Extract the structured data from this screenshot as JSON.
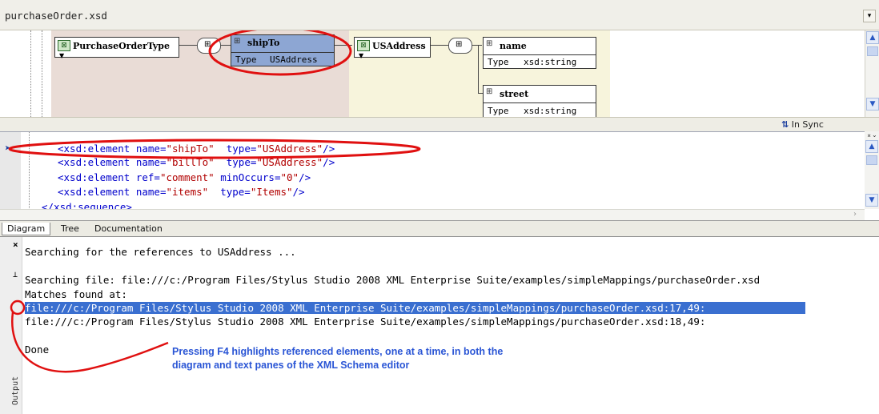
{
  "window": {
    "title": "purchaseOrder.xsd",
    "dropdown_icon": "chevron-down-icon"
  },
  "diagram": {
    "nodes": [
      {
        "label": "PurchaseOrderType"
      },
      {
        "label": "shipTo",
        "type_label": "Type",
        "type_value": "USAddress"
      },
      {
        "label": "USAddress"
      },
      {
        "label": "name",
        "type_label": "Type",
        "type_value": "xsd:string"
      },
      {
        "label": "street",
        "type_label": "Type",
        "type_value": "xsd:string"
      }
    ]
  },
  "sync": {
    "label": "In Sync",
    "icon": "sync-arrows-icon"
  },
  "code": {
    "lines": [
      {
        "tag": "<xsd:element",
        "a1": " name=",
        "v1": "\"shipTo\"",
        "a2": "  type=",
        "v2": "\"USAddress\"",
        "end": "/>"
      },
      {
        "tag": "<xsd:element",
        "a1": " name=",
        "v1": "\"billTo\"",
        "a2": "  type=",
        "v2": "\"USAddress\"",
        "end": "/>"
      },
      {
        "tag": "<xsd:element",
        "a1": " ref=",
        "v1": "\"comment\"",
        "a2": " minOccurs=",
        "v2": "\"0\"",
        "end": "/>"
      },
      {
        "tag": "<xsd:element",
        "a1": " name=",
        "v1": "\"items\"",
        "a2": "  type=",
        "v2": "\"Items\"",
        "end": "/>"
      }
    ],
    "partial_line": "</xsd:sequence>"
  },
  "tabs": [
    "Diagram",
    "Tree",
    "Documentation"
  ],
  "output": {
    "panel_label": "Output",
    "lines": [
      "Searching for the references to USAddress ...",
      "",
      "Searching file: file:///c:/Program Files/Stylus Studio 2008 XML Enterprise Suite/examples/simpleMappings/purchaseOrder.xsd",
      "Matches found at:",
      "file:///c:/Program Files/Stylus Studio 2008 XML Enterprise Suite/examples/simpleMappings/purchaseOrder.xsd:17,49:",
      "file:///c:/Program Files/Stylus Studio 2008 XML Enterprise Suite/examples/simpleMappings/purchaseOrder.xsd:18,49:",
      "",
      "Done"
    ],
    "selected_index": 4
  },
  "annotation": {
    "line1": "Pressing F4 highlights referenced elements, one at a time, in both the",
    "line2": "diagram and text panes of the XML Schema editor",
    "color": "#e01010"
  }
}
